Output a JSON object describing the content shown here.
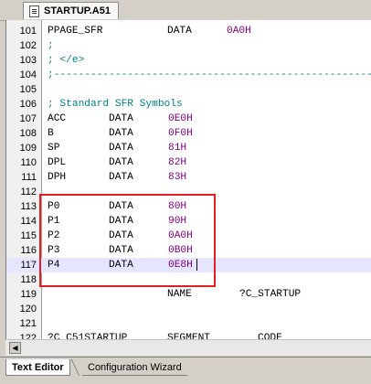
{
  "file_tab": {
    "label": "STARTUP.A51",
    "icon": "file-icon"
  },
  "lines": [
    {
      "num": "101",
      "label": "PPAGE_SFR",
      "op": "DATA",
      "value": "0A0H"
    },
    {
      "num": "102",
      "comment": ";"
    },
    {
      "num": "103",
      "comment": "; </e>"
    },
    {
      "num": "104",
      "comment": ";-----------------------------------------------------"
    },
    {
      "num": "105"
    },
    {
      "num": "106",
      "comment": "; Standard SFR Symbols"
    },
    {
      "num": "107",
      "label": "ACC",
      "op": "DATA",
      "value": "0E0H"
    },
    {
      "num": "108",
      "label": "B",
      "op": "DATA",
      "value": "0F0H"
    },
    {
      "num": "109",
      "label": "SP",
      "op": "DATA",
      "value": "81H"
    },
    {
      "num": "110",
      "label": "DPL",
      "op": "DATA",
      "value": "82H"
    },
    {
      "num": "111",
      "label": "DPH",
      "op": "DATA",
      "value": "83H"
    },
    {
      "num": "112"
    },
    {
      "num": "113",
      "label": "P0",
      "op": "DATA",
      "value": "80H"
    },
    {
      "num": "114",
      "label": "P1",
      "op": "DATA",
      "value": "90H"
    },
    {
      "num": "115",
      "label": "P2",
      "op": "DATA",
      "value": "0A0H"
    },
    {
      "num": "116",
      "label": "P3",
      "op": "DATA",
      "value": "0B0H"
    },
    {
      "num": "117",
      "label": "P4",
      "op": "DATA",
      "value": "0E8H",
      "active": true
    },
    {
      "num": "118"
    },
    {
      "num": "119",
      "op": "NAME",
      "value": "?C_STARTUP",
      "value_plain": true
    },
    {
      "num": "120"
    },
    {
      "num": "121"
    },
    {
      "num": "122",
      "label": "?C_C51STARTUP",
      "op": "SEGMENT",
      "value": "CODE",
      "value_plain": true
    }
  ],
  "bottom_tabs": {
    "active": "Text Editor",
    "inactive": "Configuration Wizard"
  },
  "colors": {
    "comment": "#008080",
    "number": "#800080",
    "highlight": "#e02020",
    "active_line": "#e5e5ff"
  }
}
